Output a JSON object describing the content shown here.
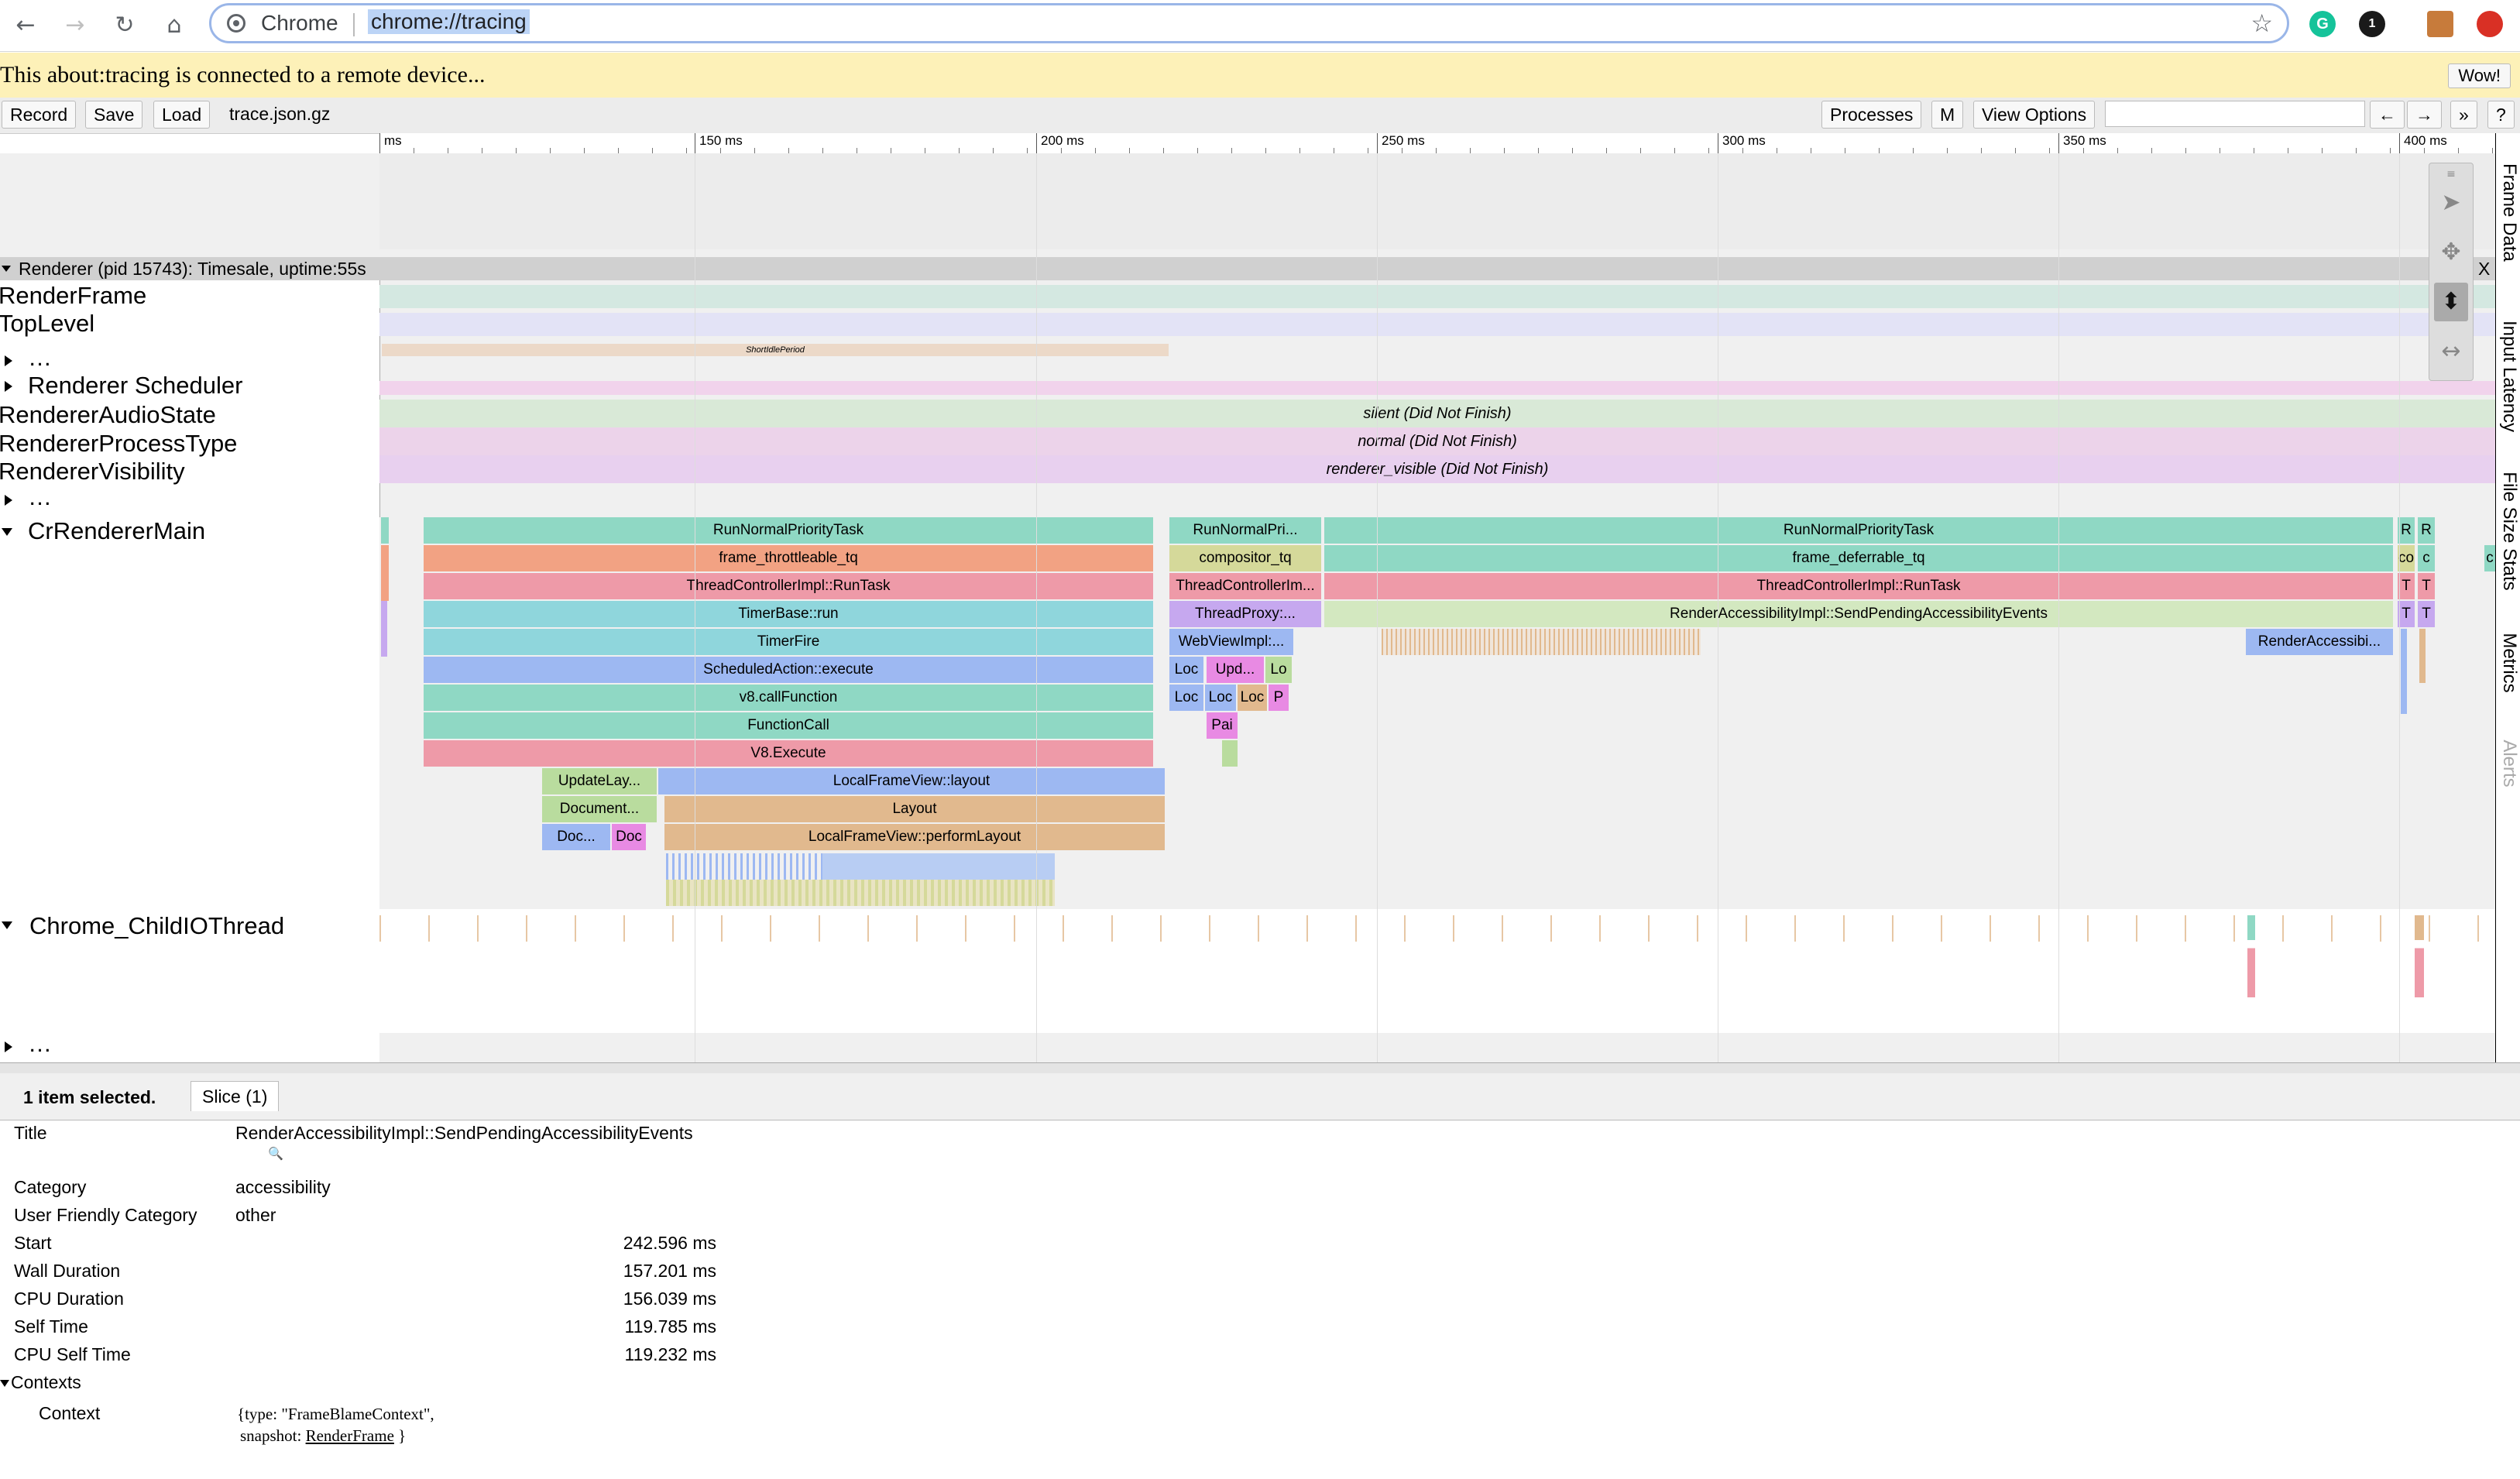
{
  "browser": {
    "omnibox_site": "Chrome",
    "url": "chrome://tracing",
    "back_icon": "←",
    "forward_icon": "→",
    "reload_icon": "↻",
    "home_icon": "⌂",
    "star_icon": "☆",
    "extensions": [
      {
        "name": "grammarly-icon",
        "glyph": "G",
        "color": "#15c39a"
      },
      {
        "name": "onepassword-icon",
        "glyph": "1",
        "color": "#1a1a1a"
      },
      {
        "name": "profile-avatar",
        "glyph": "",
        "color": "#c77b3b"
      },
      {
        "name": "adblock-icon",
        "glyph": "",
        "color": "#d93025"
      }
    ]
  },
  "banner": {
    "text": "This about:tracing is connected to a remote device...",
    "button": "Wow!"
  },
  "toolbar": {
    "record": "Record",
    "save": "Save",
    "load": "Load",
    "file": "trace.json.gz",
    "processes": "Processes",
    "m": "M",
    "view_options": "View Options",
    "search_placeholder": "",
    "prev": "←",
    "next": "→",
    "more": "»",
    "help": "?"
  },
  "ruler": {
    "labels": [
      "ms",
      "150 ms",
      "200 ms",
      "250 ms",
      "300 ms",
      "350 ms",
      "400 ms"
    ]
  },
  "side_tabs": [
    "Frame Data",
    "Input Latency",
    "File Size Stats",
    "Metrics",
    "Alerts"
  ],
  "process": {
    "header": "Renderer (pid 15743): Timesale, uptime:55s",
    "close": "X"
  },
  "tracks": {
    "render_frame": "RenderFrame",
    "top_level": "TopLevel",
    "ellipsis": "…",
    "scheduler": "Renderer Scheduler",
    "audio_state": "RendererAudioState",
    "process_type": "RendererProcessType",
    "visibility": "RendererVisibility",
    "main": "CrRendererMain",
    "io": "Chrome_ChildIOThread"
  },
  "bands": {
    "short_idle": "ShortIdlePeriod",
    "audio": "silent (Did Not Finish)",
    "type": "normal (Did Not Finish)",
    "visible": "renderer_visible (Did Not Finish)"
  },
  "slices": {
    "a_row0": "RunNormalPriorityTask",
    "a_row1": "frame_throttleable_tq",
    "a_row2": "ThreadControllerImpl::RunTask",
    "a_row3": "TimerBase::run",
    "a_row4": "TimerFire",
    "a_row5": "ScheduledAction::execute",
    "a_row6": "v8.callFunction",
    "a_row7": "FunctionCall",
    "a_row8": "V8.Execute",
    "a_upd": "UpdateLay...",
    "a_lfv": "LocalFrameView::layout",
    "a_doc": "Document...",
    "a_layout": "Layout",
    "a_doc2": "Doc...",
    "a_doc3": "Doc",
    "a_perf": "LocalFrameView::performLayout",
    "b_row0": "RunNormalPri...",
    "b_row1": "compositor_tq",
    "b_row2": "ThreadControllerIm...",
    "b_row3": "ThreadProxy:...",
    "b_row4": "WebViewImpl:...",
    "b_loc": "Loc",
    "b_upd": "Upd...",
    "b_lo": "Lo",
    "b_p": "P",
    "b_pai": "Pai",
    "c_row0": "RunNormalPriorityTask",
    "c_row1": "frame_deferrable_tq",
    "c_row2": "ThreadControllerImpl::RunTask",
    "c_row3": "RenderAccessibilityImpl::SendPendingAccessibilityEvents",
    "c_ra": "RenderAccessibi...",
    "d_r": "R",
    "d_co": "co",
    "d_c": "c",
    "d_t": "T"
  },
  "detail": {
    "selected": "1 item selected.",
    "tab": "Slice (1)",
    "title_label": "Title",
    "title_value": "RenderAccessibilityImpl::SendPendingAccessibilityEvents",
    "magnifier": "🔍",
    "category_label": "Category",
    "category_value": "accessibility",
    "ufc_label": "User Friendly Category",
    "ufc_value": "other",
    "start_label": "Start",
    "start_value": "242.596 ms",
    "wall_label": "Wall Duration",
    "wall_value": "157.201 ms",
    "cpu_label": "CPU Duration",
    "cpu_value": "156.039 ms",
    "self_label": "Self Time",
    "self_value": "119.785 ms",
    "cpuself_label": "CPU Self Time",
    "cpuself_value": "119.232 ms",
    "contexts_label": "Contexts",
    "context_label": "Context",
    "context_line1": "{type: \"FrameBlameContext\",",
    "context_line2_prefix": "snapshot: ",
    "context_link": "RenderFrame",
    "context_line2_suffix": " }"
  },
  "colors": {
    "teal": "#8fd8c4",
    "salmon": "#f2a283",
    "pink": "#ee9aa8",
    "cyan": "#8fd6dc",
    "blue": "#9db8f2",
    "green": "#b9dc9e",
    "tan": "#e1b98e",
    "lavender": "#c6a8ef",
    "magenta": "#e88ae3",
    "olive": "#d5d99a"
  }
}
